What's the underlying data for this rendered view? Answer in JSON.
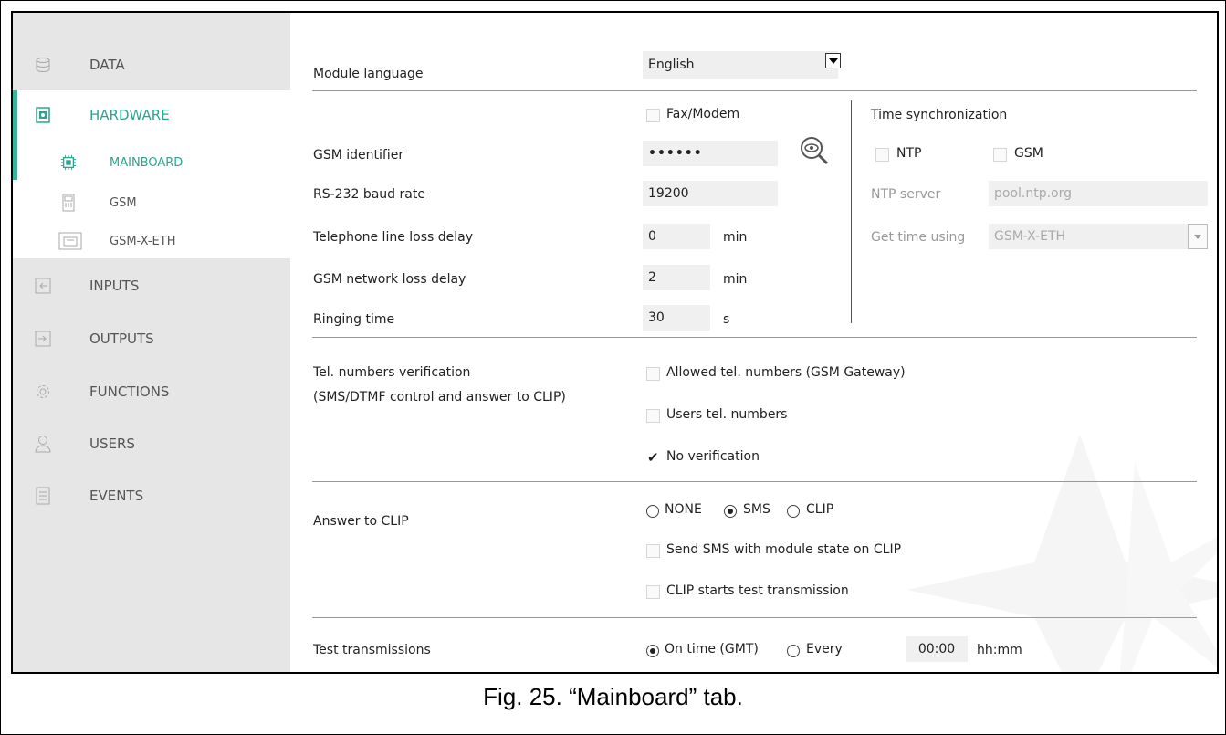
{
  "caption": "Fig. 25. “Mainboard” tab.",
  "sidebar": {
    "data": "DATA",
    "hardware": "HARDWARE",
    "mainboard": "MAINBOARD",
    "gsm": "GSM",
    "gsm_x_eth": "GSM-X-ETH",
    "inputs": "INPUTS",
    "outputs": "OUTPUTS",
    "functions": "FUNCTIONS",
    "users": "USERS",
    "events": "EVENTS"
  },
  "form": {
    "module_language_label": "Module language",
    "module_language_value": "English",
    "fax_modem": "Fax/Modem",
    "gsm_identifier_label": "GSM identifier",
    "gsm_identifier_value": "••••••",
    "baud_label": "RS-232 baud rate",
    "baud_value": "19200",
    "tel_loss_label": "Telephone line loss delay",
    "tel_loss_value": "0",
    "gsm_loss_label": "GSM network loss delay",
    "gsm_loss_value": "2",
    "ringing_label": "Ringing time",
    "ringing_value": "30",
    "unit_min": "min",
    "unit_s": "s",
    "time_sync_label": "Time synchronization",
    "ntp": "NTP",
    "gsm": "GSM",
    "ntp_server_label": "NTP server",
    "ntp_server_value": "pool.ntp.org",
    "get_time_label": "Get time using",
    "get_time_value": "GSM-X-ETH",
    "tel_verif_label_1": "Tel. numbers verification",
    "tel_verif_label_2": "(SMS/DTMF control and answer to CLIP)",
    "allowed_numbers": "Allowed tel. numbers (GSM Gateway)",
    "users_numbers": "Users tel. numbers",
    "no_verification": "No verification",
    "answer_clip_label": "Answer to CLIP",
    "opt_none": "NONE",
    "opt_sms": "SMS",
    "opt_clip": "CLIP",
    "send_sms": "Send SMS with module state on CLIP",
    "clip_test": "CLIP starts test transmission",
    "test_tx_label": "Test transmissions",
    "on_time": "On time (GMT)",
    "every": "Every",
    "time_value": "00:00",
    "time_unit": "hh:mm"
  },
  "colors": {
    "accent": "#2aa58e",
    "sidebar_bg": "#e6e6e6",
    "field_bg": "#f0f0f0"
  }
}
